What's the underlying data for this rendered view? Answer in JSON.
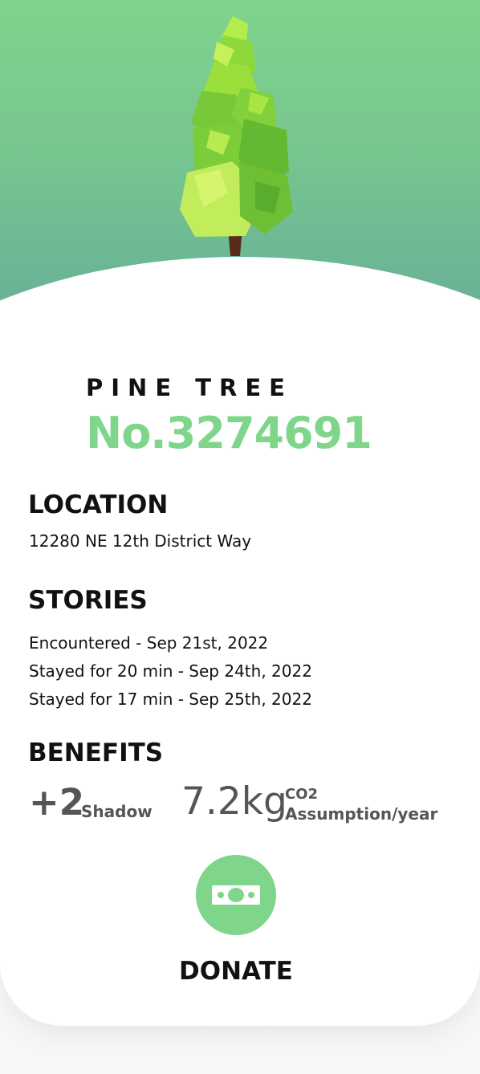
{
  "tree": {
    "type": "PINE TREE",
    "number": "No.3274691"
  },
  "location": {
    "title": "LOCATION",
    "address": "12280 NE 12th District Way"
  },
  "stories": {
    "title": "STORIES",
    "items": [
      "Encountered - Sep 21st, 2022",
      "Stayed for 20 min - Sep 24th, 2022",
      "Stayed for 17 min - Sep 25th, 2022"
    ]
  },
  "benefits": {
    "title": "BENEFITS",
    "shadow_value": "+2",
    "shadow_label": "Shadow",
    "co2_value": "7.2kg",
    "co2_unit": "CO2",
    "co2_label": "Assumption/year"
  },
  "donate": {
    "label": "DONATE",
    "icon": "money-icon"
  },
  "colors": {
    "accent": "#7fd68b",
    "hero_top": "#80d38c",
    "hero_bottom": "#66ad98",
    "text": "#111111",
    "muted": "#555555"
  }
}
